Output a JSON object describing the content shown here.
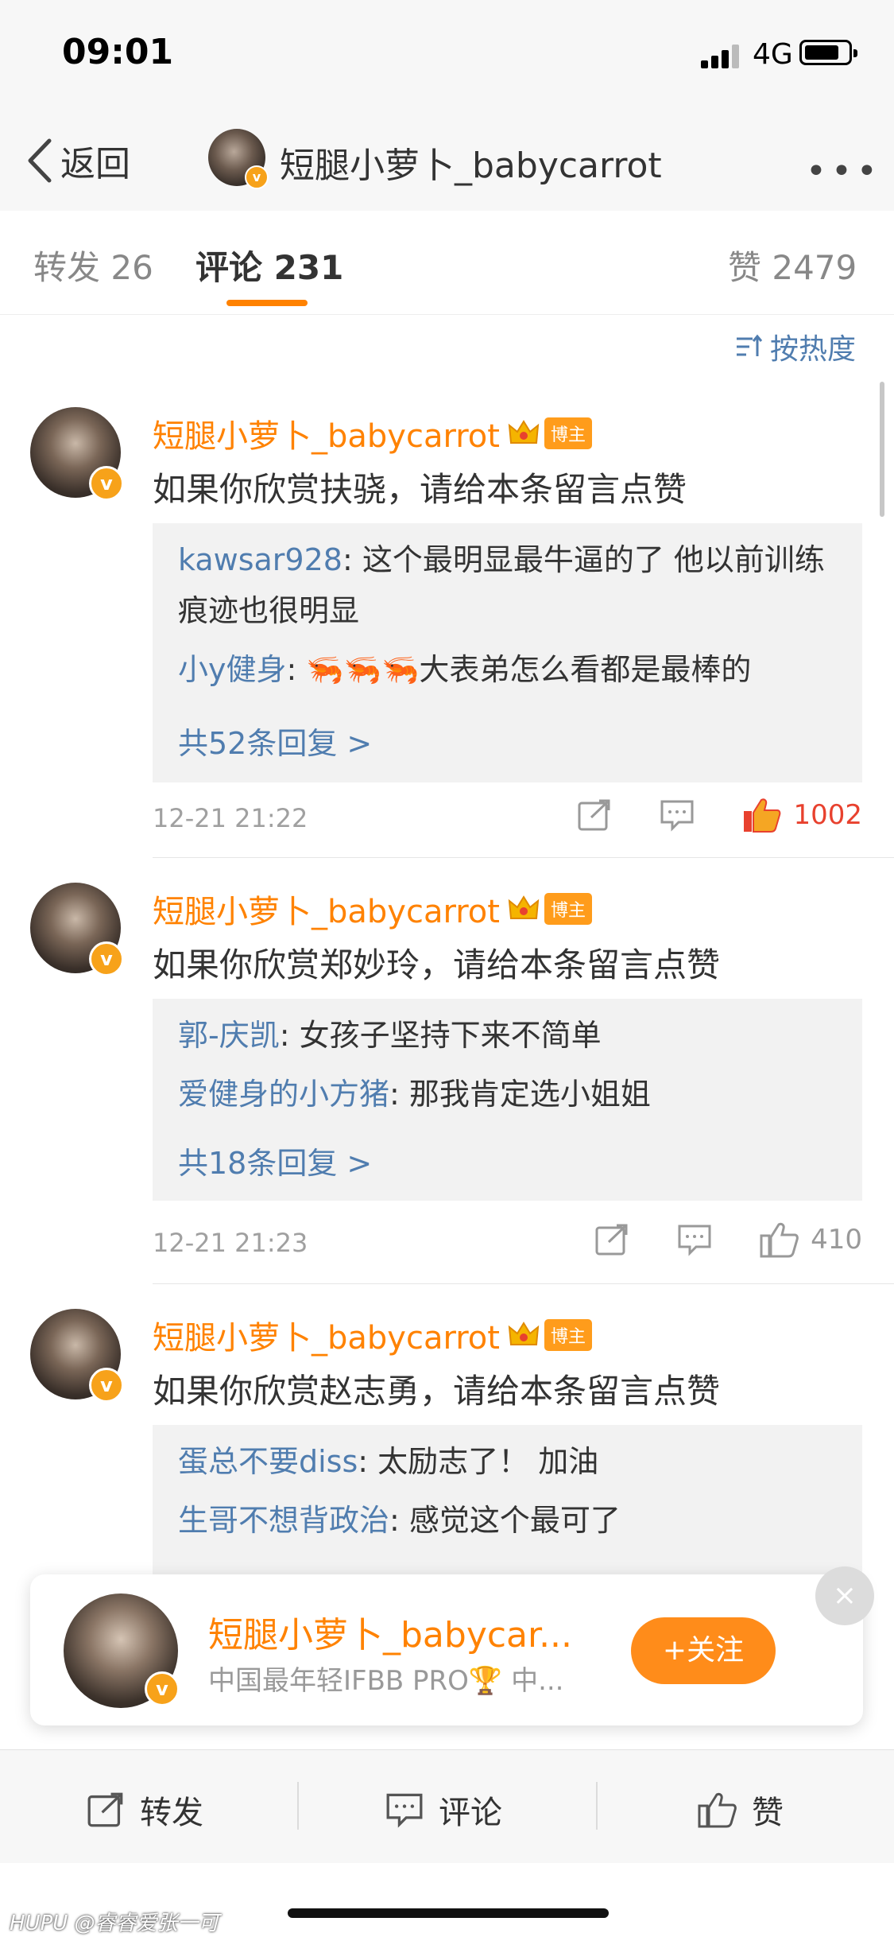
{
  "status_bar": {
    "time": "09:01",
    "network": "4G"
  },
  "nav": {
    "back_label": "返回",
    "title": "短腿小萝卜_babycarrot",
    "more": "•••"
  },
  "tabs": [
    {
      "label": "转发 26"
    },
    {
      "label": "评论 231"
    },
    {
      "label": "赞 2479"
    }
  ],
  "sort_label": "按热度",
  "comments": [
    {
      "author": "短腿小萝卜_babycarrot",
      "tag": "博主",
      "text": "如果你欣赏扶骁，请给本条留言点赞",
      "replies": [
        {
          "who": "kawsar928",
          "text": ": 这个最明显最牛逼的了 他以前训练痕迹也很明显"
        },
        {
          "who": "小y健身",
          "text": ": 🦐🦐🦐大表弟怎么看都是最棒的"
        }
      ],
      "reply_total": "共52条回复 >",
      "time": "12-21 21:22",
      "likes": "1002"
    },
    {
      "author": "短腿小萝卜_babycarrot",
      "tag": "博主",
      "text": "如果你欣赏郑妙玲，请给本条留言点赞",
      "replies": [
        {
          "who": "郭-庆凯",
          "text": ": 女孩子坚持下来不简单"
        },
        {
          "who": "爱健身的小方猪",
          "text": ": 那我肯定选小姐姐"
        }
      ],
      "reply_total": "共18条回复 >",
      "time": "12-21 21:23",
      "likes": "410"
    },
    {
      "author": "短腿小萝卜_babycarrot",
      "tag": "博主",
      "text": "如果你欣赏赵志勇，请给本条留言点赞",
      "replies": [
        {
          "who": "蛋总不要diss",
          "text": ": 太励志了！ 加油"
        },
        {
          "who": "生哥不想背政治",
          "text": ": 感觉这个最可了"
        }
      ]
    }
  ],
  "follow_card": {
    "name": "短腿小萝卜_babycar...",
    "desc": "中国最年轻IFBB PRO🏆 中...",
    "button": "+关注",
    "close": "×"
  },
  "bottom_bar": {
    "repost": "转发",
    "comment": "评论",
    "like": "赞"
  },
  "watermark": "HUPU @睿睿爱张一可",
  "colors": {
    "accent": "#ff8200",
    "link": "#507daf",
    "like_active": "#e8412e"
  }
}
